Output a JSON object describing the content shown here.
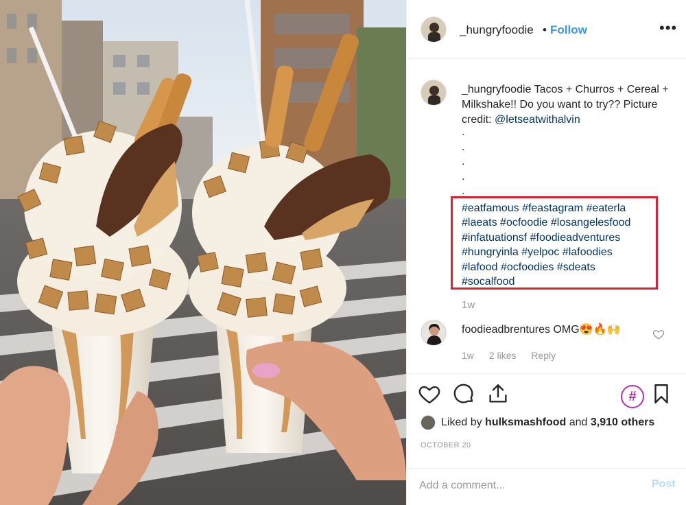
{
  "photo": {
    "alt": "Two milkshakes topped with churros and cereal"
  },
  "header": {
    "username": "_hungryfoodie",
    "separator": "•",
    "follow_label": "Follow",
    "more_label": "•••"
  },
  "caption": {
    "username": "_hungryfoodie",
    "text": " Tacos + Churros + Cereal + Milkshake!! Do you want to try?? Picture credit: ",
    "mention": "@letseatwithalvin",
    "dots": [
      ".",
      ".",
      ".",
      ".",
      "."
    ],
    "hashtags": [
      "#eatfamous",
      "#feastagram",
      "#eaterla",
      "#laeats",
      "#ocfoodie",
      "#losangelesfood",
      "#infatuationsf",
      "#foodieadventures",
      "#hungryinla",
      "#yelpoc",
      "#lafoodies",
      "#lafood",
      "#ocfoodies",
      "#sdeats",
      "#socalfood"
    ],
    "time": "1w"
  },
  "comment": {
    "username": "foodieadbrentures",
    "text": " OMG😍🔥🙌",
    "time": "1w",
    "likes": "2 likes",
    "reply_label": "Reply"
  },
  "actions": {
    "hashtag_badge": "#"
  },
  "likes": {
    "prefix": "Liked by ",
    "liker": "hulksmashfood",
    "middle": " and ",
    "others": "3,910 others"
  },
  "date": "OCTOBER 20",
  "add_comment": {
    "placeholder": "Add a comment...",
    "post_label": "Post"
  },
  "colors": {
    "link_blue": "#3897f0",
    "hashtag_blue": "#003569",
    "highlight_red": "#e0202f",
    "muted_gray": "#999999"
  }
}
